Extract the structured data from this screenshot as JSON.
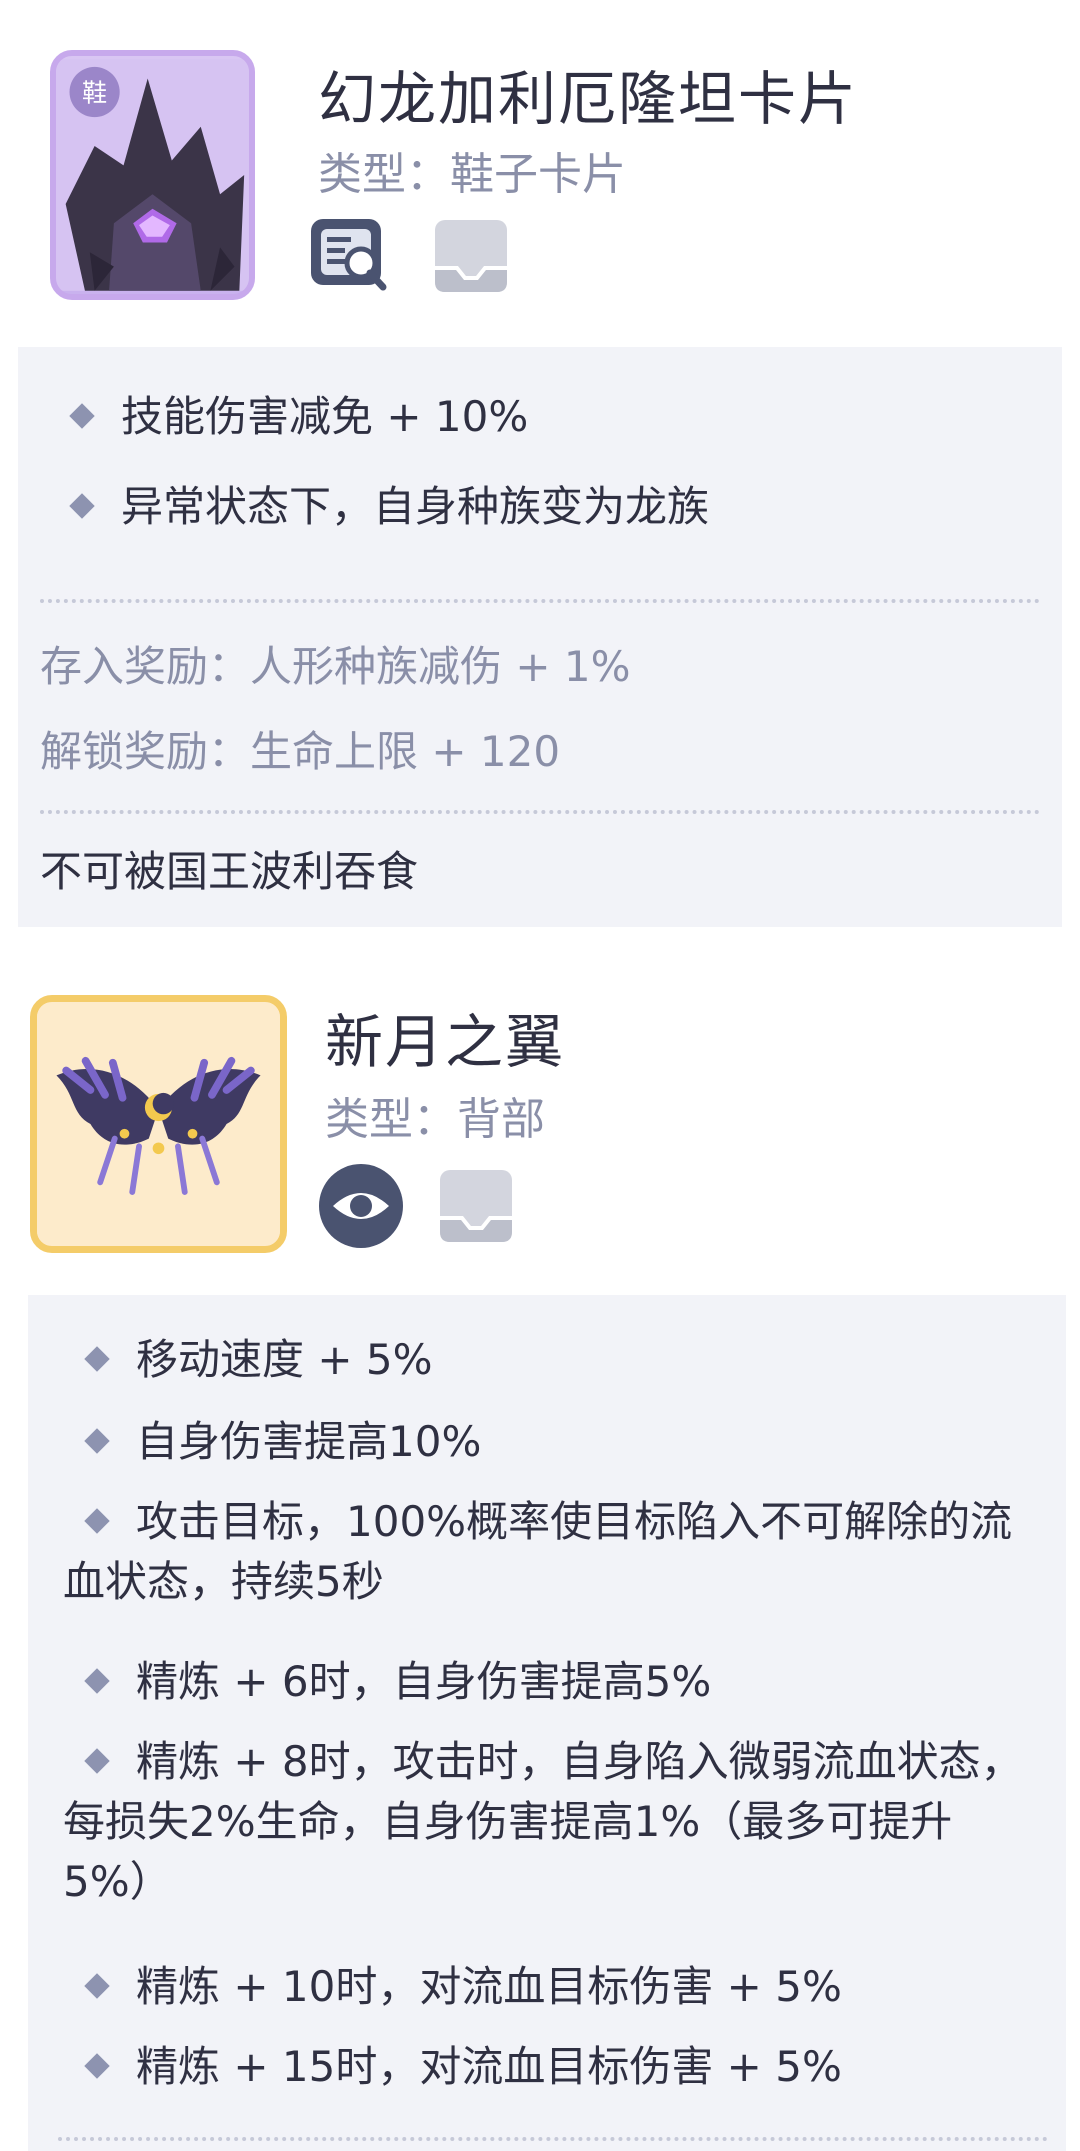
{
  "items": [
    {
      "name": "幻龙加利厄隆坦卡片",
      "type_label": "类型：鞋子卡片",
      "icon": "dragon-card-icon",
      "badges": [
        "magnify-document-icon",
        "inbox-tray-icon"
      ],
      "attributes": [
        "技能伤害减免 + 10%",
        "异常状态下，自身种族变为龙族"
      ],
      "deposit_reward": "存入奖励：人形种族减伤 + 1%",
      "unlock_reward": "解锁奖励：生命上限 + 120",
      "note": "不可被国王波利吞食"
    },
    {
      "name": "新月之翼",
      "type_label": "类型：背部",
      "icon": "crescent-wings-icon",
      "badges": [
        "eye-icon",
        "inbox-tray-icon"
      ],
      "attributes": [
        "移动速度 + 5%",
        "自身伤害提高10%",
        "攻击目标，100%概率使目标陷入不可解除的流血状态，持续5秒",
        "精炼 + 6时，自身伤害提高5%",
        "精炼 + 8时，攻击时，自身陷入微弱流血状态，每损失2%生命，自身伤害提高1%（最多可提升5%）",
        "精炼 + 10时，对流血目标伤害 + 5%",
        "精炼 + 15时，对流血目标伤害 + 5%"
      ]
    }
  ],
  "colors": {
    "panel_bg": "#f2f3f8",
    "bullet": "#8d93b0",
    "muted_text": "#8a8fa8",
    "card_frame": "#c7a9ec",
    "wings_frame": "#f4cc69"
  }
}
